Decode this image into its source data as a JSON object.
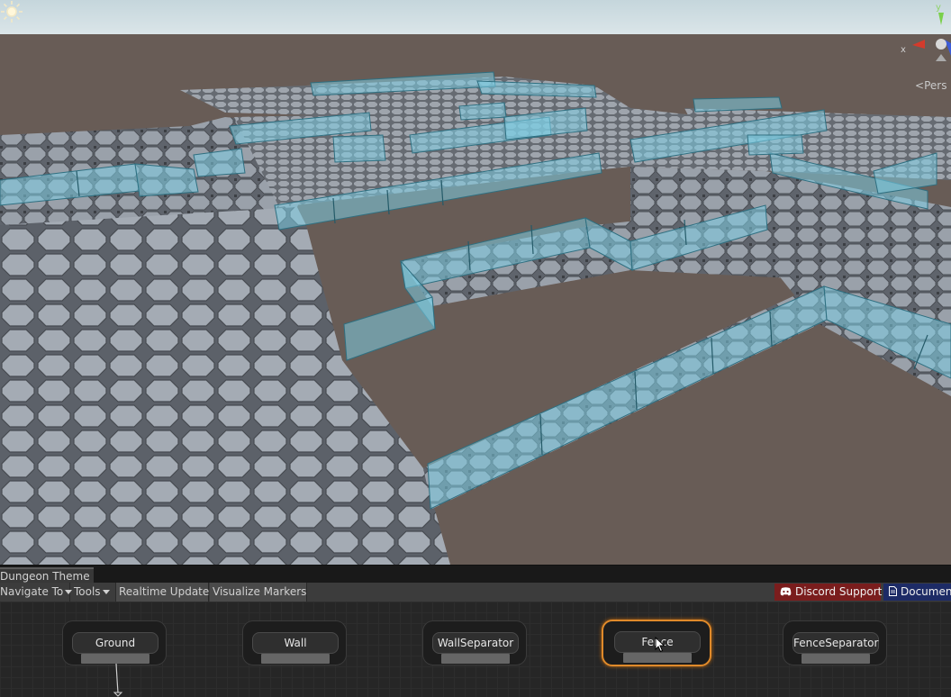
{
  "scene_view": {
    "gizmo": {
      "y_label": "y",
      "x_label": "x",
      "projection_label": "Pers"
    }
  },
  "panel": {
    "tab_title": "Dungeon Theme",
    "toolbar": {
      "navigate_to": "Navigate To",
      "tools": "Tools",
      "realtime_update": "Realtime Update",
      "visualize_markers": "Visualize Markers",
      "discord_support": "Discord Support",
      "documentation": "Document"
    },
    "nodes": [
      {
        "label": "Ground"
      },
      {
        "label": "Wall"
      },
      {
        "label": "WallSeparator"
      },
      {
        "label": "Fence"
      },
      {
        "label": "FenceSeparator"
      }
    ]
  },
  "colors": {
    "selected_node_border": "#e08a2a",
    "discord_button": "#7a1d1d",
    "docs_button": "#1d2b66",
    "fence_glass": "#7ecde3"
  }
}
